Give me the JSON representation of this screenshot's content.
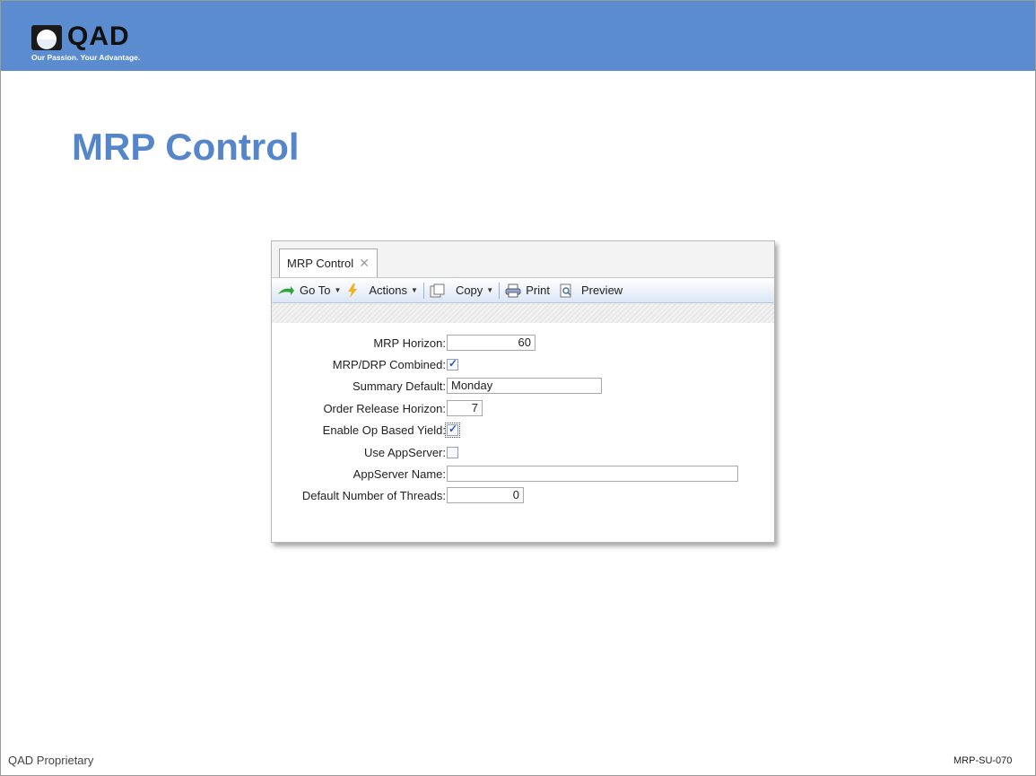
{
  "header": {
    "logo_text": "QAD",
    "tagline": "Our Passion. Your Advantage."
  },
  "slide": {
    "title": "MRP Control"
  },
  "window": {
    "tab_label": "MRP Control",
    "tab_close_icon": "close-icon",
    "toolbar": {
      "goto_label": "Go To",
      "actions_label": "Actions",
      "copy_label": "Copy",
      "print_label": "Print",
      "preview_label": "Preview"
    },
    "fields": {
      "mrp_horizon": {
        "label": "MRP Horizon:",
        "value": "60"
      },
      "mrp_drp_combined": {
        "label": "MRP/DRP Combined:",
        "checked": true
      },
      "summary_default": {
        "label": "Summary Default:",
        "value": "Monday"
      },
      "order_release_horizon": {
        "label": "Order Release Horizon:",
        "value": "7"
      },
      "enable_op_based_yield": {
        "label": "Enable Op Based Yield:",
        "checked": true
      },
      "use_appserver": {
        "label": "Use AppServer:",
        "checked": false
      },
      "appserver_name": {
        "label": "AppServer Name:",
        "value": ""
      },
      "default_threads": {
        "label": "Default Number of Threads:",
        "value": "0"
      }
    }
  },
  "footer": {
    "left": "QAD Proprietary",
    "right": "MRP-SU-070"
  },
  "colors": {
    "header_bar": "#5a8ccf",
    "title": "#5586c9",
    "checkmark": "#2a56b8"
  }
}
